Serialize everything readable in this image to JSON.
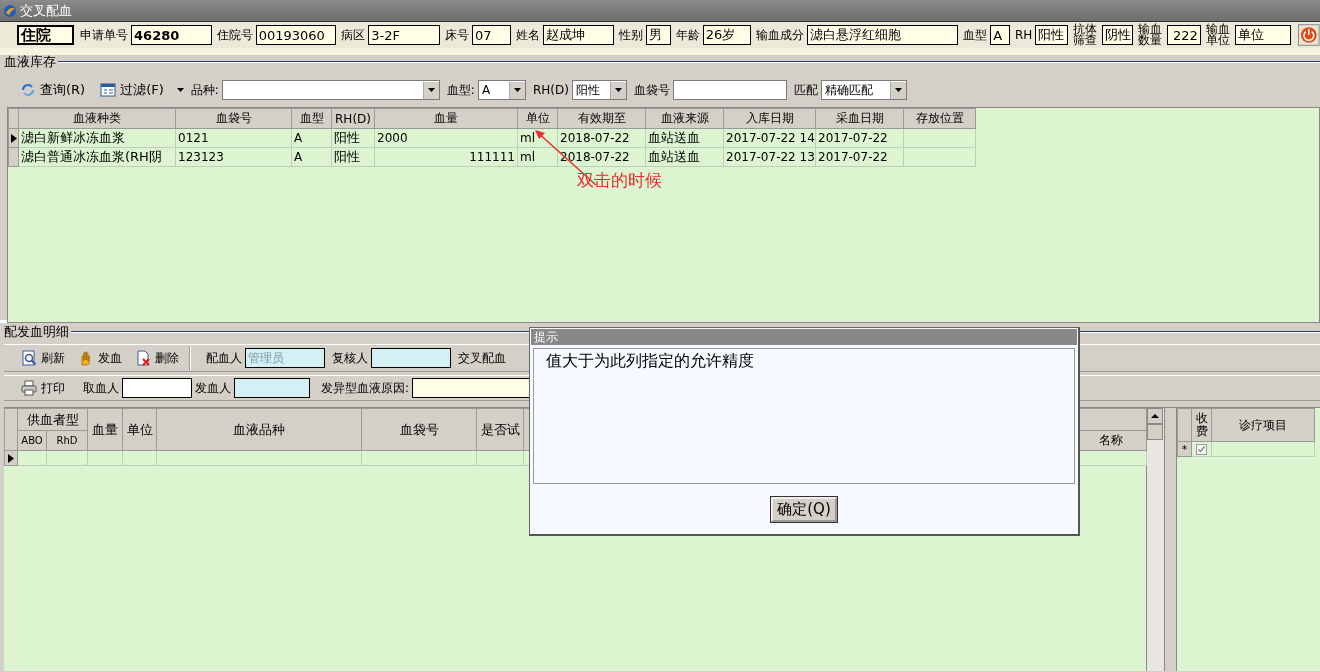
{
  "window": {
    "title": "交叉配血"
  },
  "header": {
    "patient_type": "住院",
    "fields": [
      {
        "label": "申请单号",
        "value": "46280",
        "bold": true
      },
      {
        "label": "住院号",
        "value": "00193060",
        "bold": false
      },
      {
        "label": "病区",
        "value": "3-2F",
        "bold": false
      },
      {
        "label": "床号",
        "value": "07",
        "bold": false
      },
      {
        "label": "姓名",
        "value": "赵成坤",
        "bold": false
      },
      {
        "label": "性别",
        "value": "男",
        "bold": false
      },
      {
        "label": "年龄",
        "value": "26岁",
        "bold": false
      },
      {
        "label": "输血成分",
        "value": "滤白悬浮红细胞",
        "bold": false
      },
      {
        "label": "血型",
        "value": "A",
        "bold": false
      },
      {
        "label": "RH",
        "value": "阳性",
        "bold": false
      },
      {
        "label": "抗体筛查",
        "value": "阴性",
        "bold": false
      },
      {
        "label": "输血数量",
        "value": "222",
        "bold": false
      },
      {
        "label": "输血单位",
        "value": "单位",
        "bold": false
      }
    ]
  },
  "stock": {
    "title": "血液库存",
    "toolbar": {
      "buttons": [
        "查询(R)",
        "过滤(F)"
      ],
      "filters": [
        {
          "kind": "select",
          "label": "品种:"
        },
        {
          "kind": "select",
          "label": "血型:",
          "value": "A"
        },
        {
          "kind": "select",
          "label": "RH(D)",
          "value": "阳性"
        },
        {
          "kind": "input",
          "label": "血袋号"
        },
        {
          "kind": "select",
          "label": "匹配",
          "value": "精确匹配"
        }
      ]
    },
    "table": {
      "columns": [
        "血液种类",
        "血袋号",
        "血型",
        "RH(D)",
        "血量",
        "单位",
        "有效期至",
        "血液来源",
        "入库日期",
        "采血日期",
        "存放位置"
      ],
      "rows": [
        {
          "selected": true,
          "cells": [
            "滤白新鲜冰冻血浆",
            "0121",
            "A",
            "阳性",
            "2000",
            "ml",
            "2018-07-22",
            "血站送血",
            "2017-07-22 14",
            "2017-07-22",
            ""
          ]
        },
        {
          "selected": false,
          "cells": [
            "滤白普通冰冻血浆(RH阴",
            "123123",
            "A",
            "阳性",
            "111111",
            "ml",
            "2018-07-22",
            "血站送血",
            "2017-07-22 13",
            "2017-07-22",
            ""
          ]
        }
      ]
    },
    "annotation": "双击的时候"
  },
  "detail": {
    "title": "配发血明细",
    "toolbar": {
      "buttons": [
        "刷新",
        "发血",
        "删除"
      ],
      "fields": [
        {
          "label": "配血人",
          "placeholder": "管理员"
        },
        {
          "label": "复核人"
        }
      ],
      "trailing_label": "交叉配血"
    },
    "toolbar2": {
      "button": "打印",
      "fields": [
        {
          "label": "取血人"
        },
        {
          "label": "发血人"
        },
        {
          "label": "发异型血液原因:"
        }
      ]
    },
    "grid": {
      "group_header": "供血者型",
      "sub_columns": [
        "ABO",
        "RhD"
      ],
      "columns": [
        "血量",
        "单位",
        "血液品种",
        "血袋号",
        "是否试"
      ],
      "last_column": "名称"
    },
    "side_grid": {
      "columns": [
        "收费",
        "诊疗项目"
      ],
      "rows": [
        {
          "marker": "*",
          "charged": true
        }
      ]
    }
  },
  "dialog": {
    "title": "提示",
    "message": "值大于为此列指定的允许精度",
    "button": "确定(Q)"
  }
}
